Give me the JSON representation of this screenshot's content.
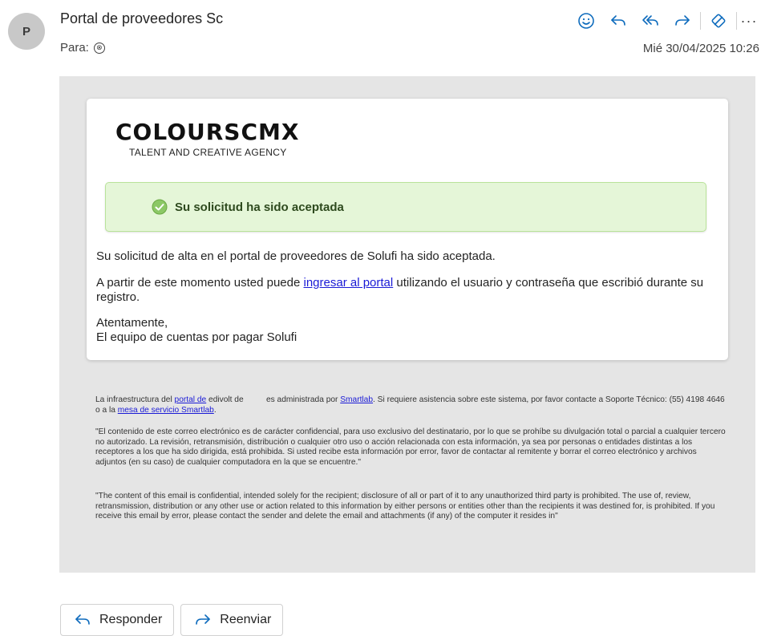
{
  "header": {
    "avatar_initial": "P",
    "sender": "Portal de proveedores Sc",
    "to_label": "Para:",
    "remove_recipient_glyph": "⊗",
    "date": "Mié 30/04/2025 10:26",
    "more_glyph": "···"
  },
  "toolbar_icons": [
    "emoji-icon",
    "reply-icon",
    "reply-all-icon",
    "forward-icon",
    "sensitivity-icon",
    "more-icon"
  ],
  "logo": {
    "name": "COLOURSCMX",
    "tagline": "TALENT AND CREATIVE AGENCY"
  },
  "alert": {
    "text": "Su solicitud ha sido aceptada",
    "color": "#e5f6d8",
    "icon_color": "#7cbf4f"
  },
  "body": {
    "p1": "Su solicitud de alta en el portal de proveedores de Solufi ha sido aceptada.",
    "p2_before": "A partir de este momento usted puede ",
    "p2_link": "ingresar al portal",
    "p2_after": " utilizando el usuario y contraseña que escribió durante su registro.",
    "closing": "Atentamente,",
    "signature": "El equipo de cuentas por pagar Solufi"
  },
  "footer": {
    "infra_before": "La infraestructura del ",
    "infra_link1": "portal de",
    "infra_mid1": " edivolt de          es administrada por ",
    "infra_link2": "Smartlab",
    "infra_mid2": ". Si requiere asistencia sobre este sistema, por favor contacte a Soporte Técnico: (55) 4198 4646 o a la ",
    "infra_link3": "mesa de servicio Smartlab",
    "infra_end": ".",
    "disclaimer_es": "\"El contenido de este correo electrónico es de carácter confidencial, para uso exclusivo del destinatario, por lo que se prohíbe su divulgación total o parcial a cualquier tercero no autorizado. La revisión, retransmisión, distribución o cualquier otro uso o acción relacionada con esta información, ya sea por personas o entidades distintas a los receptores a los que ha sido dirigida, está prohibida. Si usted recibe esta información por error, favor de contactar al remitente y borrar el correo electrónico y archivos adjuntos (en su caso) de cualquier computadora en la que se encuentre.\"",
    "disclaimer_en": "\"The content of this email is confidential, intended solely for the recipient; disclosure of all or part of it to any unauthorized third party is prohibited. The use of, review, retransmission, distribution or any other use or action related to this information by either persons or entities other than the recipients it was destined for, is prohibited. If you receive this email by error, please contact the sender and delete the email and attachments (if any) of the computer it resides in\""
  },
  "buttons": {
    "reply": "Responder",
    "forward": "Reenviar"
  },
  "colors": {
    "accent": "#0f6cbd",
    "link": "#1a1ad6",
    "body_bg": "#e5e5e5"
  }
}
